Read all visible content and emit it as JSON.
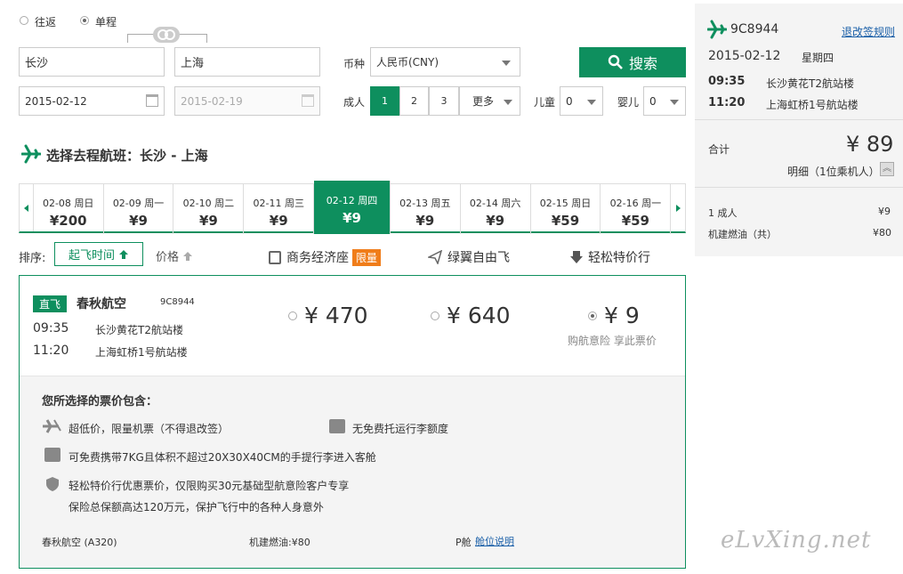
{
  "trip": {
    "roundtrip_label": "往返",
    "oneway_label": "单程"
  },
  "search": {
    "from": "长沙",
    "to": "上海",
    "currency_label": "币种",
    "currency_value": "人民币(CNY)",
    "search_button": "搜索",
    "depart_date": "2015-02-12",
    "return_date": "2015-02-19",
    "adult_label": "成人",
    "adult_options": [
      "1",
      "2",
      "3"
    ],
    "more_label": "更多",
    "child_label": "儿童",
    "child_value": "0",
    "infant_label": "婴儿",
    "infant_value": "0"
  },
  "section_title": "选择去程航班：长沙 - 上海",
  "dates": [
    {
      "date": "02-08",
      "weekday": "周日",
      "price": "¥200"
    },
    {
      "date": "02-09",
      "weekday": "周一",
      "price": "¥9"
    },
    {
      "date": "02-10",
      "weekday": "周二",
      "price": "¥9"
    },
    {
      "date": "02-11",
      "weekday": "周三",
      "price": "¥9"
    },
    {
      "date": "02-12",
      "weekday": "周四",
      "price": "¥9"
    },
    {
      "date": "02-13",
      "weekday": "周五",
      "price": "¥9"
    },
    {
      "date": "02-14",
      "weekday": "周六",
      "price": "¥9"
    },
    {
      "date": "02-15",
      "weekday": "周日",
      "price": "¥59"
    },
    {
      "date": "02-16",
      "weekday": "周一",
      "price": "¥59"
    }
  ],
  "sort": {
    "label": "排序:",
    "time_label": "起飞时间",
    "price_label": "价格",
    "col1": "商务经济座",
    "col1_badge": "限量",
    "col2": "绿翼自由飞",
    "col3": "轻松特价行"
  },
  "flight": {
    "tag": "直飞",
    "airline": "春秋航空",
    "number": "9C8944",
    "dep_time": "09:35",
    "dep_airport": "长沙黄花T2航站楼",
    "arr_time": "11:20",
    "arr_airport": "上海虹桥1号航站楼",
    "price1": "¥ 470",
    "price2": "¥ 640",
    "price3": "¥ 9",
    "price3_note": "购航意险 享此票价"
  },
  "details": {
    "title": "您所选择的票价包含：",
    "item1": "超低价，限量机票（不得退改签）",
    "item2": "无免费托运行李额度",
    "item3": "可免费携带7KG且体积不超过20X30X40CM的手提行李进入客舱",
    "item4a": "轻松特价行优惠票价，仅限购买30元基础型航意险客户专享",
    "item4b": "保险总保额高达120万元，保护飞行中的各种人身意外",
    "aircraft": "春秋航空 (A320)",
    "fuel": "机建燃油:¥80",
    "cabin": "P舱",
    "cabin_link": "舱位说明"
  },
  "summary": {
    "flight_no": "9C8944",
    "rules_link": "退改签规则",
    "date": "2015-02-12",
    "weekday": "星期四",
    "dep_time": "09:35",
    "dep_airport": "长沙黄花T2航站楼",
    "arr_time": "11:20",
    "arr_airport": "上海虹桥1号航站楼",
    "total_label": "合计",
    "total_value": "¥ 89",
    "detail_label": "明细（1位乘机人）",
    "adult_label": "1 成人",
    "adult_value": "¥9",
    "fuel_label": "机建燃油（共）",
    "fuel_value": "¥80"
  },
  "watermark": "eLvXing.net",
  "colors": {
    "accent": "#0e8f5e",
    "badge": "#f07d1a"
  }
}
